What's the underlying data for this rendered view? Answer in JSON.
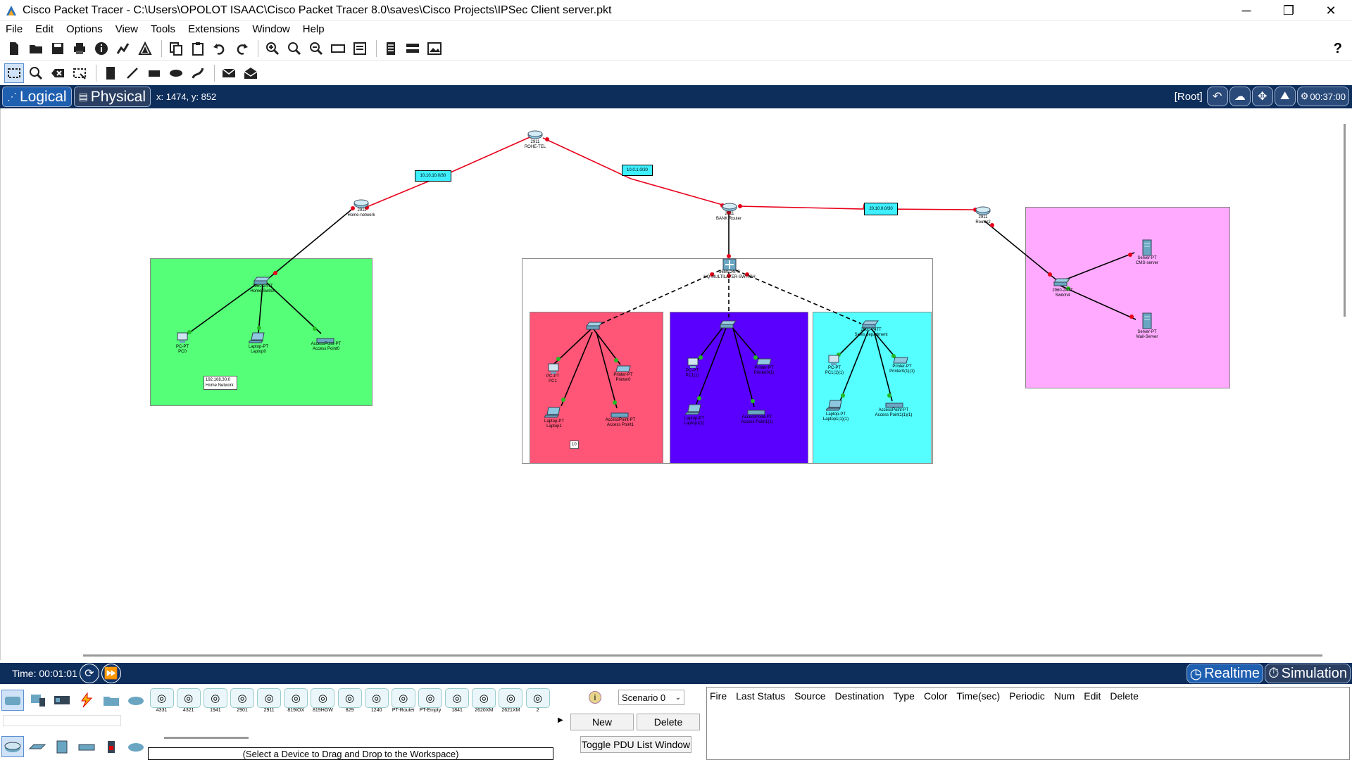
{
  "window": {
    "title": "Cisco Packet Tracer - C:\\Users\\OPOLOT ISAAC\\Cisco Packet Tracer 8.0\\saves\\Cisco Projects\\IPSec Client server.pkt",
    "minimize": "─",
    "maximize": "❐",
    "close": "✕"
  },
  "menu": [
    "File",
    "Edit",
    "Options",
    "View",
    "Tools",
    "Extensions",
    "Window",
    "Help"
  ],
  "viewbar": {
    "logical": "Logical",
    "physical": "Physical",
    "coords": "x: 1474, y: 852",
    "root": "[Root]",
    "clock": "00:37:00"
  },
  "help_symbol": "?",
  "network": {
    "routers": {
      "rohe": {
        "model": "2911",
        "name": "ROHE-TEL"
      },
      "home": {
        "model": "2911",
        "name": "Home-network"
      },
      "bank": {
        "model": "2911",
        "name": "BANK Router"
      },
      "router2": {
        "model": "2911",
        "name": "Router2"
      }
    },
    "links": {
      "l1": "10.10.10.0/30",
      "l2": "10.0.1.0/30",
      "l3": "20.10.0.0/30"
    },
    "home_switch": {
      "model": "2960-24TT",
      "name": "Home Switch"
    },
    "home_devices": {
      "pc0": {
        "type": "PC-PT",
        "name": "PC0"
      },
      "laptop0": {
        "type": "Laptop-PT",
        "name": "Laptop0"
      },
      "ap0": {
        "type": "AccessPoint-PT",
        "name": "Access Point0"
      }
    },
    "home_note": {
      "line1": "192.168.30.0",
      "line2": "Home Network"
    },
    "multilayer": {
      "model": "3650-24PS",
      "name": "HQ-MULTILAYER-SWITCH"
    },
    "red_zone": {
      "pc1": {
        "type": "PC-PT",
        "name": "PC1"
      },
      "printer0": {
        "type": "Printer-PT",
        "name": "Printer0"
      },
      "laptop1": {
        "type": "Laptop-PT",
        "name": "Laptop1"
      },
      "ap1": {
        "type": "AccessPoint-PT",
        "name": "Access Point1"
      },
      "tag": "10"
    },
    "blue_zone": {
      "pc1": {
        "type": "PC-PT",
        "name": "PC1(1)"
      },
      "printer": {
        "type": "Printer-PT",
        "name": "Printer0(1)"
      },
      "laptop": {
        "type": "Laptop-PT",
        "name": "Laptop1(1)"
      },
      "ap": {
        "type": "AccessPoint-PT",
        "name": "Access Point1(1)"
      }
    },
    "cyan_zone": {
      "switch": {
        "model": "2960-24TT",
        "name": "Sales department"
      },
      "pc": {
        "type": "PC-PT",
        "name": "PC1(1)(1)"
      },
      "printer": {
        "type": "Printer-PT",
        "name": "Printer0(1)(1)"
      },
      "laptop": {
        "type": "Laptop-PT",
        "name": "Laptop1(1)(1)"
      },
      "ap": {
        "type": "AccessPoint-PT",
        "name": "Access Point1(1)(1)"
      }
    },
    "server_zone": {
      "switch": {
        "model": "2960-24TT",
        "name": "Switch4"
      },
      "cms": {
        "type": "Server-PT",
        "name": "CMS-server"
      },
      "mail": {
        "type": "Server-PT",
        "name": "Mail-Server"
      }
    }
  },
  "timebar": {
    "time": "Time: 00:01:01",
    "realtime": "Realtime",
    "simulation": "Simulation"
  },
  "devices": [
    "4331",
    "4321",
    "1941",
    "2901",
    "2911",
    "819IOX",
    "819HGW",
    "829",
    "1240",
    "PT-Router",
    "PT-Empty",
    "1841",
    "2620XM",
    "2621XM",
    "2"
  ],
  "hint": "(Select a Device to Drag and Drop to the Workspace)",
  "scenario": {
    "info": "i",
    "selected": "Scenario 0",
    "new": "New",
    "delete": "Delete",
    "toggle": "Toggle PDU List Window"
  },
  "pdu_headers": [
    "Fire",
    "Last Status",
    "Source",
    "Destination",
    "Type",
    "Color",
    "Time(sec)",
    "Periodic",
    "Num",
    "Edit",
    "Delete"
  ],
  "colors": {
    "home_zone": "#55ff77",
    "red_zone": "#ff5577",
    "blue_zone": "#5a00ff",
    "cyan_zone": "#55ffff",
    "server_zone": "#ffaaff",
    "serial_link": "#e8001a",
    "bar": "#0d2d5a"
  }
}
